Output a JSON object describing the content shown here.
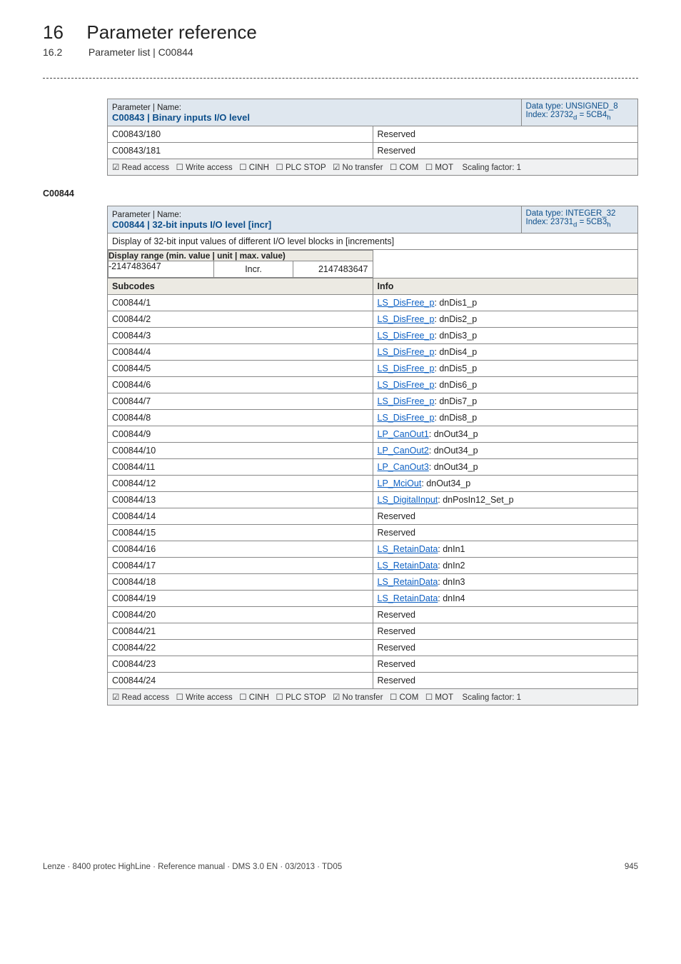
{
  "chapter": {
    "num": "16",
    "title": "Parameter reference"
  },
  "section": {
    "num": "16.2",
    "title": "Parameter list | C00844"
  },
  "table1": {
    "header_label": "Parameter | Name:",
    "header_name": "C00843 | Binary inputs I/O level",
    "datatype_label": "Data type: UNSIGNED_8",
    "index_label": "Index: 23732",
    "index_sub_d": "d",
    "index_eq": " = 5CB4",
    "index_sub_h": "h",
    "rows": [
      {
        "code": "C00843/180",
        "val": "Reserved"
      },
      {
        "code": "C00843/181",
        "val": "Reserved"
      }
    ],
    "flags": "☑ Read access   ☐ Write access   ☐ CINH   ☐ PLC STOP   ☑ No transfer   ☐ COM   ☐ MOT    Scaling factor: 1"
  },
  "anchor": "C00844",
  "table2": {
    "header_label": "Parameter | Name:",
    "header_name": "C00844 | 32-bit inputs I/O level [incr]",
    "datatype_label": "Data type: INTEGER_32",
    "index_label": "Index: 23731",
    "index_sub_d": "d",
    "index_eq": " = 5CB3",
    "index_sub_h": "h",
    "desc": "Display of 32-bit input values of different I/O level blocks in [increments]",
    "display_range_label": "Display range (min. value | unit | max. value)",
    "range_min": "-2147483647",
    "range_unit": "Incr.",
    "range_max": "2147483647",
    "subcodes_label": "Subcodes",
    "info_label": "Info",
    "rows": [
      {
        "code": "C00844/1",
        "link": "LS_DisFree_p",
        "suffix": ": dnDis1_p"
      },
      {
        "code": "C00844/2",
        "link": "LS_DisFree_p",
        "suffix": ": dnDis2_p"
      },
      {
        "code": "C00844/3",
        "link": "LS_DisFree_p",
        "suffix": ": dnDis3_p"
      },
      {
        "code": "C00844/4",
        "link": "LS_DisFree_p",
        "suffix": ": dnDis4_p"
      },
      {
        "code": "C00844/5",
        "link": "LS_DisFree_p",
        "suffix": ": dnDis5_p"
      },
      {
        "code": "C00844/6",
        "link": "LS_DisFree_p",
        "suffix": ": dnDis6_p"
      },
      {
        "code": "C00844/7",
        "link": "LS_DisFree_p",
        "suffix": ": dnDis7_p"
      },
      {
        "code": "C00844/8",
        "link": "LS_DisFree_p",
        "suffix": ": dnDis8_p"
      },
      {
        "code": "C00844/9",
        "link": "LP_CanOut1",
        "suffix": ": dnOut34_p"
      },
      {
        "code": "C00844/10",
        "link": "LP_CanOut2",
        "suffix": ": dnOut34_p"
      },
      {
        "code": "C00844/11",
        "link": "LP_CanOut3",
        "suffix": ": dnOut34_p"
      },
      {
        "code": "C00844/12",
        "link": "LP_MciOut",
        "suffix": ": dnOut34_p"
      },
      {
        "code": "C00844/13",
        "link": "LS_DigitalInput",
        "suffix": ": dnPosIn12_Set_p"
      },
      {
        "code": "C00844/14",
        "plain": "Reserved"
      },
      {
        "code": "C00844/15",
        "plain": "Reserved"
      },
      {
        "code": "C00844/16",
        "link": "LS_RetainData",
        "suffix": ": dnIn1"
      },
      {
        "code": "C00844/17",
        "link": "LS_RetainData",
        "suffix": ": dnIn2"
      },
      {
        "code": "C00844/18",
        "link": "LS_RetainData",
        "suffix": ": dnIn3"
      },
      {
        "code": "C00844/19",
        "link": "LS_RetainData",
        "suffix": ": dnIn4"
      },
      {
        "code": "C00844/20",
        "plain": "Reserved"
      },
      {
        "code": "C00844/21",
        "plain": "Reserved"
      },
      {
        "code": "C00844/22",
        "plain": "Reserved"
      },
      {
        "code": "C00844/23",
        "plain": "Reserved"
      },
      {
        "code": "C00844/24",
        "plain": "Reserved"
      }
    ],
    "flags": "☑ Read access   ☐ Write access   ☐ CINH   ☐ PLC STOP   ☑ No transfer   ☐ COM   ☐ MOT    Scaling factor: 1"
  },
  "footer": {
    "left": "Lenze · 8400 protec HighLine · Reference manual · DMS 3.0 EN · 03/2013 · TD05",
    "right": "945"
  }
}
